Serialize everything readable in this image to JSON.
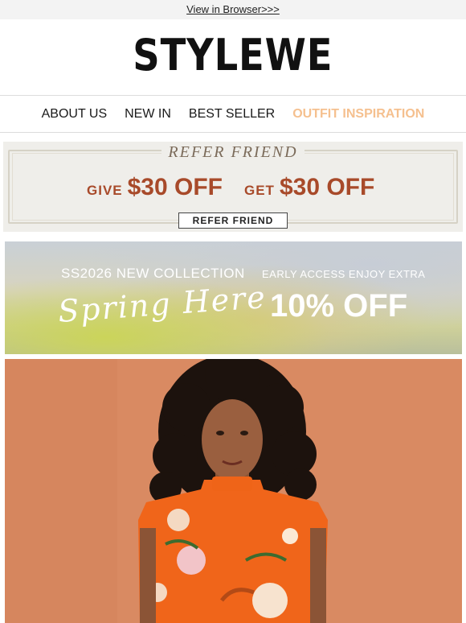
{
  "header": {
    "view_in_browser": "View in Browser>>>"
  },
  "brand": {
    "logo_text": "STYLEWE"
  },
  "nav": {
    "items": [
      {
        "label": "ABOUT US"
      },
      {
        "label": "NEW IN"
      },
      {
        "label": "BEST SELLER"
      },
      {
        "label": "OUTFIT INSPIRATION",
        "highlight": true
      }
    ]
  },
  "refer": {
    "title": "REFER FRIEND",
    "give_label": "GIVE",
    "give_value": "$30 OFF",
    "get_label": "GET",
    "get_value": "$30 OFF",
    "button_label": "REFER FRIEND"
  },
  "spring_banner": {
    "collection": "SS2026 NEW COLLECTION",
    "script_text": "Spring Here",
    "early_access": "EARLY ACCESS ENJOY EXTRA",
    "discount": "10% OFF"
  },
  "colors": {
    "accent": "#f5c08f",
    "offer_red": "#a84a2a",
    "backdrop": "#d98a62",
    "dress": "#f0651a"
  }
}
